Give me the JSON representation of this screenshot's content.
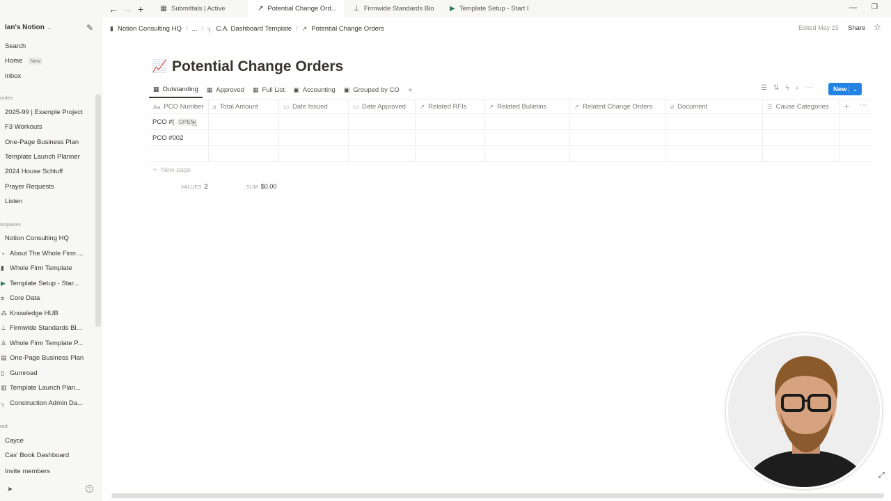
{
  "tabs": [
    {
      "label": "Submittals | Active",
      "icon": "sheet-icon"
    },
    {
      "label": "Potential Change Ord...",
      "icon": "chart-icon"
    },
    {
      "label": "Firmwide Standards Blo",
      "icon": "stamp-icon"
    },
    {
      "label": "Template Setup - Start I",
      "icon": "play-icon"
    }
  ],
  "sidebar": {
    "workspace": "Ian's Notion",
    "top": [
      {
        "label": "Search"
      },
      {
        "label": "Home",
        "badge": "New"
      },
      {
        "label": "Inbox"
      }
    ],
    "favorites_label": "orites",
    "favorites": [
      "2025-99 | Example Project",
      "F3 Workouts",
      "One-Page Business Plan",
      "Template Launch Planner",
      "2024 House Schtuff",
      "Prayer Requests",
      "Listen"
    ],
    "teamspaces_label": "mspaces",
    "teamspaces": [
      "Notion Consulting HQ",
      "About The Whole Firm ...",
      "Whole Firm Template",
      "Template Setup - Star...",
      "Core Data",
      "Knowledge HUB",
      "Firmwide Standards Bl...",
      "Whole Firm Template P...",
      "One-Page Business Plan",
      "Gumroad",
      "Template Launch Plan...",
      "Construction Admin Da..."
    ],
    "shared_label": "red",
    "shared": [
      "Cayce",
      "Cas' Book Dashboard"
    ],
    "invite": "Invite members"
  },
  "breadcrumb": [
    "Notion Consulting HQ",
    "...",
    "C.A. Dashboard Template",
    "Potential Change Orders"
  ],
  "edited": "Edited May 23",
  "share": "Share",
  "page": {
    "title": "Potential Change Orders"
  },
  "views": [
    "Outstanding",
    "Approved",
    "Full List",
    "Accounting",
    "Grouped by CO"
  ],
  "new_button": "New",
  "columns": [
    {
      "label": "PCO Number",
      "icon": "Aa"
    },
    {
      "label": "Total Amount",
      "icon": "#"
    },
    {
      "label": "Date Issued",
      "icon": "calendar-icon"
    },
    {
      "label": "Date Approved",
      "icon": "calendar-icon"
    },
    {
      "label": "Related RFIs",
      "icon": "arrow-icon"
    },
    {
      "label": "Related Bulletins",
      "icon": "arrow-icon"
    },
    {
      "label": "Related Change Orders",
      "icon": "arrow-icon"
    },
    {
      "label": "Document",
      "icon": "paperclip-icon"
    },
    {
      "label": "Cause Categories",
      "icon": "list-icon"
    }
  ],
  "rows": [
    {
      "name": "PCO #(",
      "chip": "OPEN"
    },
    {
      "name": "PCO #002",
      "chip": ""
    },
    {
      "name": "",
      "chip": ""
    }
  ],
  "new_page": "New page",
  "calc": {
    "values_label": "VALUES",
    "values": "2",
    "sum_label": "SUM",
    "sum": "$0.00"
  }
}
